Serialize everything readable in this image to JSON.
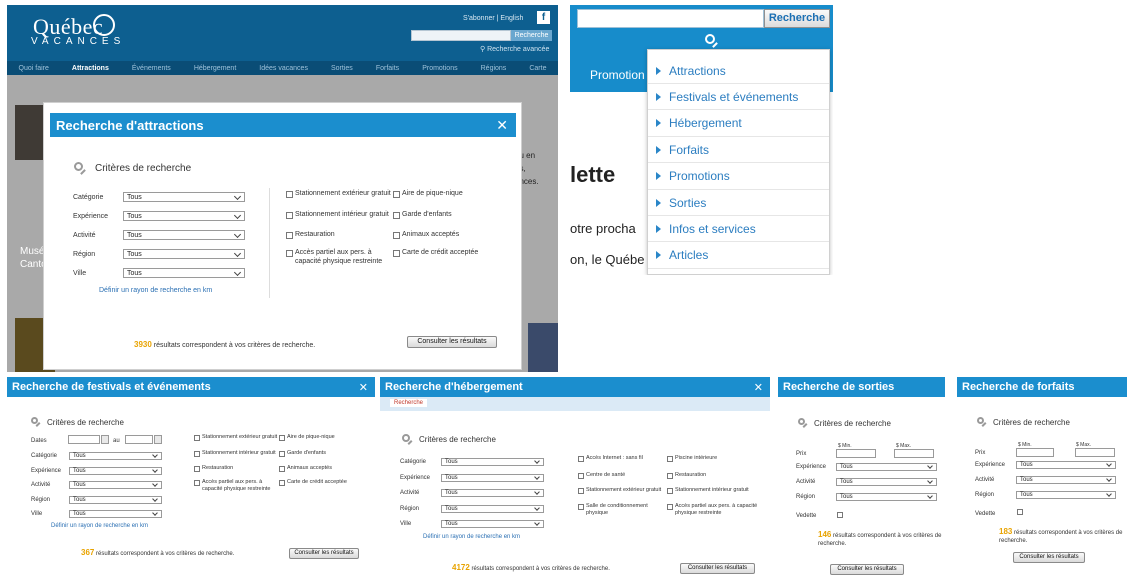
{
  "attractions_site": {
    "logo_top": "Québec",
    "logo_bottom": "VACANCES",
    "top_links": "S'abonner  |  English",
    "facebook_label": "f",
    "search_button": "Recherche",
    "advanced_search": "Recherche avancée",
    "nav": [
      "Quoi faire",
      "Attractions",
      "Événements",
      "Hébergement",
      "Idées vacances",
      "Sorties",
      "Forfaits",
      "Promotions",
      "Régions",
      "Carte"
    ],
    "nav_active": "Attractions",
    "side_text_1": "ou en",
    "side_text_2": "ns,",
    "side_text_3": "ances.",
    "bg_caption_1": "Musé",
    "bg_caption_2": "Canto",
    "modal": {
      "title": "Recherche d'attractions",
      "close": "✕",
      "criteria_heading": "Critères de recherche",
      "fields": [
        {
          "label": "Catégorie",
          "value": "Tous"
        },
        {
          "label": "Expérience",
          "value": "Tous"
        },
        {
          "label": "Activité",
          "value": "Tous"
        },
        {
          "label": "Région",
          "value": "Tous"
        },
        {
          "label": "Ville",
          "value": "Tous"
        }
      ],
      "radius_link": "Définir un rayon de recherche en km",
      "checkboxes_left": [
        "Stationnement extérieur gratuit",
        "Stationnement intérieur gratuit",
        "Restauration",
        "Accès partiel aux pers. à capacité physique restreinte"
      ],
      "checkboxes_right": [
        "Aire de pique-nique",
        "Garde d'enfants",
        "Animaux acceptés",
        "Carte de crédit acceptée"
      ],
      "result_count": "3930",
      "result_text": "résultats correspondent à vos critères de recherche.",
      "results_button": "Consulter les résultats"
    }
  },
  "dropdown_site": {
    "search_button": "Recherche",
    "promotions_label": "Promotion",
    "heading_fragment": "lette",
    "text_fragment_1": "otre procha",
    "text_fragment_2": "on, le Québe",
    "menu_items": [
      "Attractions",
      "Festivals et événements",
      "Hébergement",
      "Forfaits",
      "Promotions",
      "Sorties",
      "Infos et services",
      "Articles"
    ]
  },
  "festivals_panel": {
    "title": "Recherche de festivals et événements",
    "close": "✕",
    "criteria_heading": "Critères de recherche",
    "dates_label": "Dates",
    "dates_to": "au",
    "fields": [
      {
        "label": "Catégorie",
        "value": "Tous"
      },
      {
        "label": "Expérience",
        "value": "Tous"
      },
      {
        "label": "Activité",
        "value": "Tous"
      },
      {
        "label": "Région",
        "value": "Tous"
      },
      {
        "label": "Ville",
        "value": "Tous"
      }
    ],
    "radius_link": "Définir un rayon de recherche en km",
    "checkboxes_left": [
      "Stationnement extérieur gratuit",
      "Stationnement intérieur gratuit",
      "Restauration",
      "Accès partiel aux pers. à capacité physique restreinte"
    ],
    "checkboxes_right": [
      "Aire de pique-nique",
      "Garde d'enfants",
      "Animaux acceptés",
      "Carte de crédit acceptée"
    ],
    "result_count": "367",
    "result_text": "résultats correspondent à vos critères de recherche.",
    "results_button": "Consulter les résultats"
  },
  "hebergement_panel": {
    "title": "Recherche d'hébergement",
    "close": "✕",
    "tab": "Recherche",
    "criteria_heading": "Critères de recherche",
    "fields": [
      {
        "label": "Catégorie",
        "value": "Tous"
      },
      {
        "label": "Expérience",
        "value": "Tous"
      },
      {
        "label": "Activité",
        "value": "Tous"
      },
      {
        "label": "Région",
        "value": "Tous"
      },
      {
        "label": "Ville",
        "value": "Tous"
      }
    ],
    "radius_link": "Définir un rayon de recherche en km",
    "checkboxes_left": [
      "Accès Internet : sans fil",
      "Centre de santé",
      "Stationnement extérieur gratuit",
      "Salle de conditionnement physique"
    ],
    "checkboxes_right": [
      "Piscine intérieure",
      "Restauration",
      "Stationnement intérieur gratuit",
      "Accès partiel aux pers. à capacité physique restreinte"
    ],
    "result_count": "4172",
    "result_text": "résultats correspondent à vos critères de recherche.",
    "results_button": "Consulter les résultats"
  },
  "sorties_panel": {
    "title": "Recherche de sorties",
    "criteria_heading": "Critères de recherche",
    "price_label": "Prix",
    "min_label": "$ Min.",
    "max_label": "$ Max.",
    "fields": [
      {
        "label": "Expérience",
        "value": "Tous"
      },
      {
        "label": "Activité",
        "value": "Tous"
      },
      {
        "label": "Région",
        "value": "Tous"
      }
    ],
    "vedette_label": "Vedette",
    "result_count": "146",
    "result_text": "résultats correspondent à vos critères de recherche.",
    "results_button": "Consulter les résultats"
  },
  "forfaits_panel": {
    "title": "Recherche de forfaits",
    "criteria_heading": "Critères de recherche",
    "price_label": "Prix",
    "min_label": "$ Min.",
    "max_label": "$ Max.",
    "fields": [
      {
        "label": "Expérience",
        "value": "Tous"
      },
      {
        "label": "Activité",
        "value": "Tous"
      },
      {
        "label": "Région",
        "value": "Tous"
      }
    ],
    "vedette_label": "Vedette",
    "result_count": "183",
    "result_text": "résultats correspondent à vos critères de recherche.",
    "results_button": "Consulter les résultats"
  },
  "colors": {
    "title_bar": "#1b8ece",
    "result_count": "#e8a300",
    "link": "#2a6fb3",
    "site_header": "#0d5f90"
  }
}
